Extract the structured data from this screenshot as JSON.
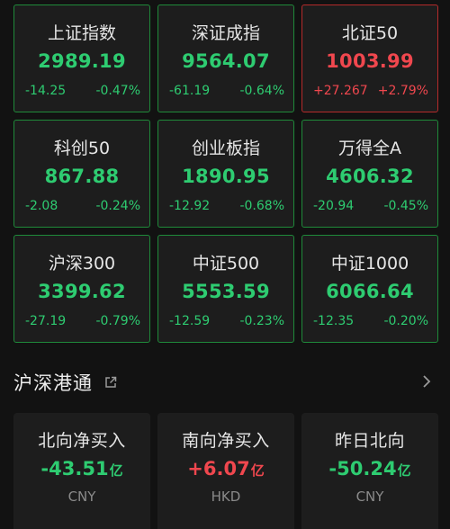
{
  "indices": [
    {
      "name": "上证指数",
      "price": "2989.19",
      "change": "-14.25",
      "pct": "-0.47%",
      "trend": "down"
    },
    {
      "name": "深证成指",
      "price": "9564.07",
      "change": "-61.19",
      "pct": "-0.64%",
      "trend": "down"
    },
    {
      "name": "北证50",
      "price": "1003.99",
      "change": "+27.267",
      "pct": "+2.79%",
      "trend": "up"
    },
    {
      "name": "科创50",
      "price": "867.88",
      "change": "-2.08",
      "pct": "-0.24%",
      "trend": "down"
    },
    {
      "name": "创业板指",
      "price": "1890.95",
      "change": "-12.92",
      "pct": "-0.68%",
      "trend": "down"
    },
    {
      "name": "万得全A",
      "price": "4606.32",
      "change": "-20.94",
      "pct": "-0.45%",
      "trend": "down"
    },
    {
      "name": "沪深300",
      "price": "3399.62",
      "change": "-27.19",
      "pct": "-0.79%",
      "trend": "down"
    },
    {
      "name": "中证500",
      "price": "5553.59",
      "change": "-12.59",
      "pct": "-0.23%",
      "trend": "down"
    },
    {
      "name": "中证1000",
      "price": "6066.64",
      "change": "-12.35",
      "pct": "-0.20%",
      "trend": "down"
    }
  ],
  "section": {
    "title": "沪深港通",
    "share_icon": "external-link-icon",
    "chevron_icon": "chevron-right-icon"
  },
  "flows": [
    {
      "label": "北向净买入",
      "value": "-43.51",
      "unit": "亿",
      "currency": "CNY",
      "trend": "down"
    },
    {
      "label": "南向净买入",
      "value": "+6.07",
      "unit": "亿",
      "currency": "HKD",
      "trend": "up"
    },
    {
      "label": "昨日北向",
      "value": "-50.24",
      "unit": "亿",
      "currency": "CNY",
      "trend": "down"
    }
  ],
  "colors": {
    "background": "#121212",
    "card": "#1d1d1d",
    "down": "#2ecc71",
    "up": "#f0474e",
    "down_border": "#1f8a3a",
    "up_border": "#b52b2b"
  }
}
